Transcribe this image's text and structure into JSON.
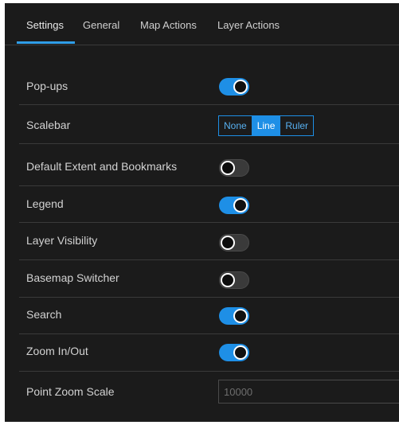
{
  "tabs": [
    {
      "label": "Settings",
      "active": true
    },
    {
      "label": "General",
      "active": false
    },
    {
      "label": "Map Actions",
      "active": false
    },
    {
      "label": "Layer Actions",
      "active": false
    }
  ],
  "settings": {
    "popups": {
      "label": "Pop-ups",
      "enabled": true
    },
    "scalebar": {
      "label": "Scalebar",
      "options": [
        "None",
        "Line",
        "Ruler"
      ],
      "selected": "Line"
    },
    "default_extent": {
      "label": "Default Extent and Bookmarks",
      "enabled": false
    },
    "legend": {
      "label": "Legend",
      "enabled": true
    },
    "layer_visibility": {
      "label": "Layer Visibility",
      "enabled": false
    },
    "basemap_switcher": {
      "label": "Basemap Switcher",
      "enabled": false
    },
    "search": {
      "label": "Search",
      "enabled": true
    },
    "zoom": {
      "label": "Zoom In/Out",
      "enabled": true
    },
    "point_zoom_scale": {
      "label": "Point Zoom Scale",
      "placeholder": "10000",
      "value": ""
    }
  },
  "colors": {
    "accent": "#1e8fe6",
    "background": "#1b1b1b",
    "divider": "#3a3a3a"
  }
}
